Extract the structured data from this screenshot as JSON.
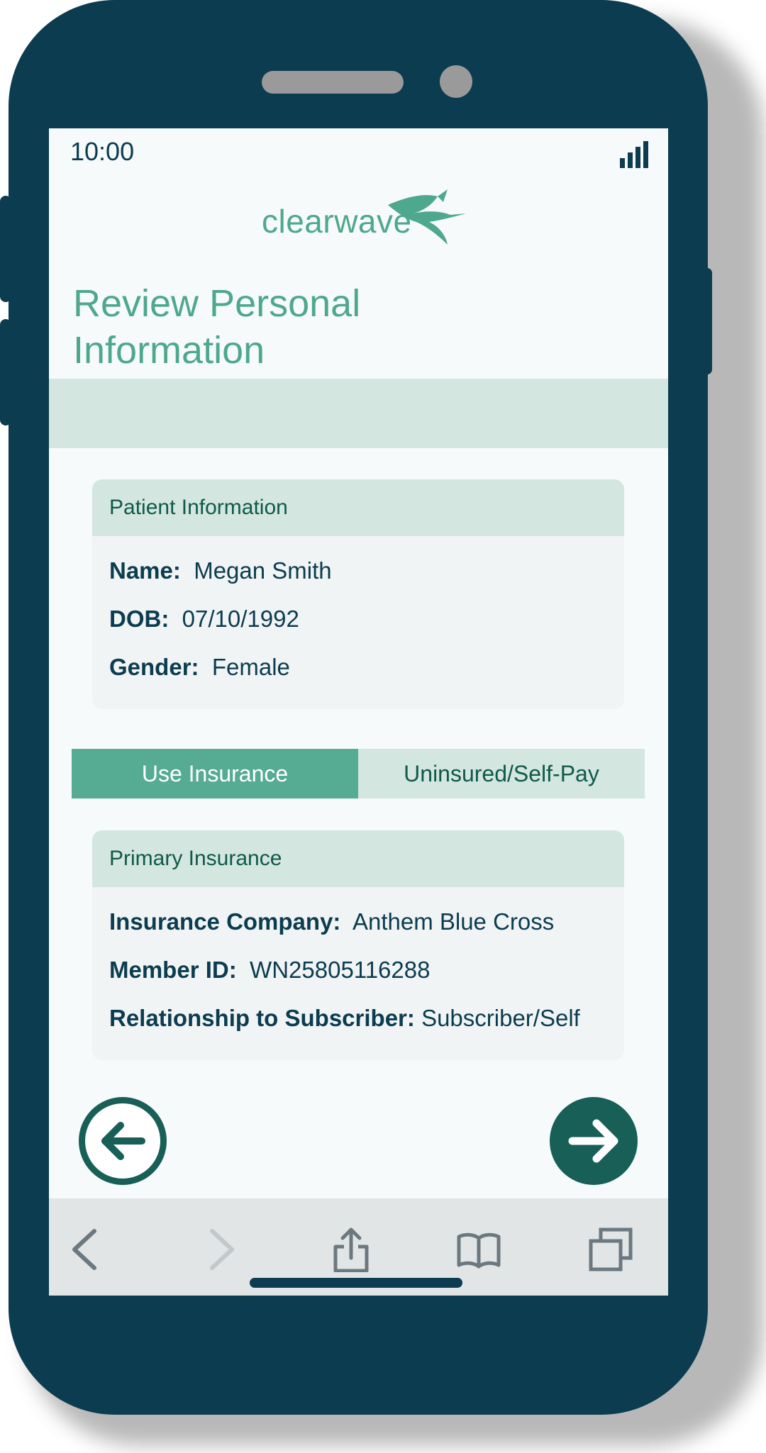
{
  "status_bar": {
    "time": "10:00"
  },
  "brand": {
    "name": "clearwave"
  },
  "page": {
    "title": "Review Personal Information"
  },
  "patient_card": {
    "header": "Patient Information",
    "rows": [
      {
        "label": "Name:",
        "value": "Megan Smith"
      },
      {
        "label": "DOB:",
        "value": "07/10/1992"
      },
      {
        "label": "Gender:",
        "value": "Female"
      }
    ]
  },
  "coverage_toggle": {
    "options": [
      "Use Insurance",
      "Uninsured/Self-Pay"
    ],
    "selected": "Use Insurance"
  },
  "insurance_card": {
    "header": "Primary Insurance",
    "rows": [
      {
        "label": "Insurance Company:",
        "value": "Anthem Blue Cross"
      },
      {
        "label": "Member ID:",
        "value": "WN25805116288"
      },
      {
        "label": "Relationship to Subscriber:",
        "value": "Subscriber/Self"
      }
    ]
  },
  "navigation": {
    "back_icon": "arrow-left-circle-icon",
    "next_icon": "arrow-right-circle-icon"
  },
  "browser_toolbar": {
    "icons": [
      "chevron-left-icon",
      "chevron-right-icon",
      "share-icon",
      "bookmarks-icon",
      "tabs-icon"
    ]
  },
  "colors": {
    "phone_body": "#0b3c50",
    "brand_green": "#4ea88e",
    "active_toggle": "#56ab93",
    "light_green": "#d3e6df",
    "nav_button": "#175f57"
  }
}
